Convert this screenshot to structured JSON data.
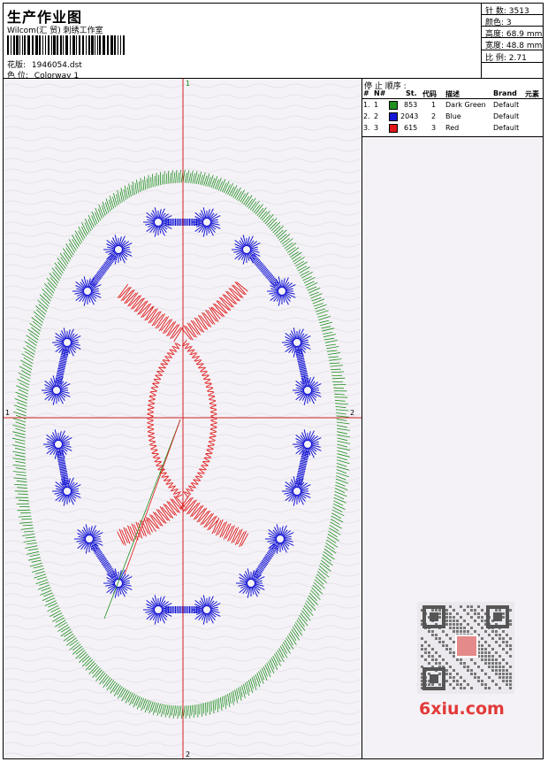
{
  "header": {
    "title": "生产作业图",
    "company": "Wilcom(汇 贸) 刺绣工作室",
    "pattern_label": "花版:",
    "pattern_value": "1946054.dst",
    "colorway_label": "色 位:",
    "colorway_value": "Colorway 1"
  },
  "stats": {
    "stitches_label": "针 数:",
    "stitches_value": "3513",
    "colors_label": "颜色:",
    "colors_value": "3",
    "height_label": "高度:",
    "height_value": "68.9 mm",
    "width_label": "宽度:",
    "width_value": "48.8 mm",
    "scale_label": "比 例:",
    "scale_value": "2.71"
  },
  "stop_sequence": {
    "title": "停 止 顺序 :",
    "headers": [
      "#",
      "N#",
      "St.",
      "代码",
      "描述",
      "Brand",
      "元素"
    ],
    "rows": [
      {
        "index": "1.",
        "n": "1",
        "color": "#1f8f1f",
        "stitches": "853",
        "code": "1",
        "description": "Dark Green",
        "brand": "Default"
      },
      {
        "index": "2.",
        "n": "2",
        "color": "#1414d4",
        "stitches": "2043",
        "code": "2",
        "description": "Blue",
        "brand": "Default"
      },
      {
        "index": "3.",
        "n": "3",
        "color": "#e01818",
        "stitches": "615",
        "code": "3",
        "description": "Red",
        "brand": "Default"
      }
    ]
  },
  "axis_markers": {
    "top": "1",
    "bottom": "2",
    "left": "1",
    "right": "2"
  },
  "watermark": {
    "text": "6xiu.com"
  },
  "colors": {
    "green": "#1f8f1f",
    "blue": "#1414d4",
    "red": "#e01818",
    "axis": "#d02020",
    "background": "#f4f2f6"
  }
}
